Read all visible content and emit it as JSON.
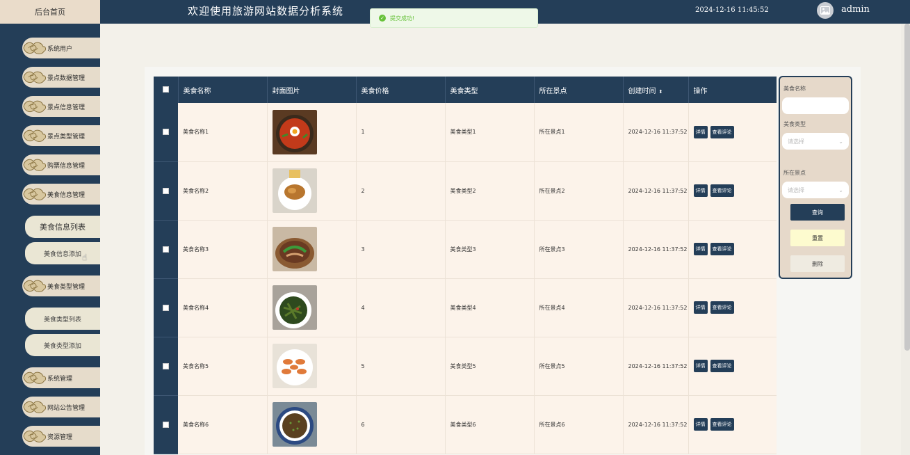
{
  "header": {
    "home_label": "后台首页",
    "app_title": "欢迎使用旅游网站数据分析系统",
    "datetime": "2024-12-16 11:45:52",
    "username": "admin"
  },
  "toast": {
    "message": "提交成功!"
  },
  "sidebar": {
    "items": [
      {
        "label": "系统用户"
      },
      {
        "label": "景点数据管理"
      },
      {
        "label": "景点信息管理"
      },
      {
        "label": "景点类型管理"
      },
      {
        "label": "购票信息管理"
      },
      {
        "label": "美食信息管理"
      },
      {
        "label": "美食类型管理"
      },
      {
        "label": "系统管理"
      },
      {
        "label": "网站公告管理"
      },
      {
        "label": "资源管理"
      }
    ],
    "food_sub": [
      {
        "label": "美食信息列表"
      },
      {
        "label": "美食信息添加"
      }
    ],
    "type_sub": [
      {
        "label": "美食类型列表"
      },
      {
        "label": "美食类型添加"
      }
    ]
  },
  "table": {
    "columns": [
      "美食名称",
      "封面图片",
      "美食价格",
      "美食类型",
      "所在景点",
      "创建时间",
      "操作"
    ],
    "detail_label": "详情",
    "comments_label": "查看评论",
    "rows": [
      {
        "name": "美食名称1",
        "price": "1",
        "type": "美食类型1",
        "spot": "所在景点1",
        "created": "2024-12-16 11:37:52",
        "img": "bibimbap"
      },
      {
        "name": "美食名称2",
        "price": "2",
        "type": "美食类型2",
        "spot": "所在景点2",
        "created": "2024-12-16 11:37:52",
        "img": "chicken"
      },
      {
        "name": "美食名称3",
        "price": "3",
        "type": "美食类型3",
        "spot": "所在景点3",
        "created": "2024-12-16 11:37:52",
        "img": "claypot"
      },
      {
        "name": "美食名称4",
        "price": "4",
        "type": "美食类型4",
        "spot": "所在景点4",
        "created": "2024-12-16 11:37:52",
        "img": "stirfry"
      },
      {
        "name": "美食名称5",
        "price": "5",
        "type": "美食类型5",
        "spot": "所在景点5",
        "created": "2024-12-16 11:37:52",
        "img": "shrimp"
      },
      {
        "name": "美食名称6",
        "price": "6",
        "type": "美食类型6",
        "spot": "所在景点6",
        "created": "2024-12-16 11:37:52",
        "img": "mince"
      }
    ]
  },
  "search": {
    "name_label": "美食名称",
    "type_label": "美食类型",
    "spot_label": "所在景点",
    "select_placeholder": "请选择",
    "query_label": "查询",
    "reset_label": "重置",
    "delete_label": "删除"
  },
  "colors": {
    "primary": "#243e58",
    "sidebar_item": "#e6dccb",
    "row_bg": "#fcf3ea",
    "success": "#67c23a"
  }
}
